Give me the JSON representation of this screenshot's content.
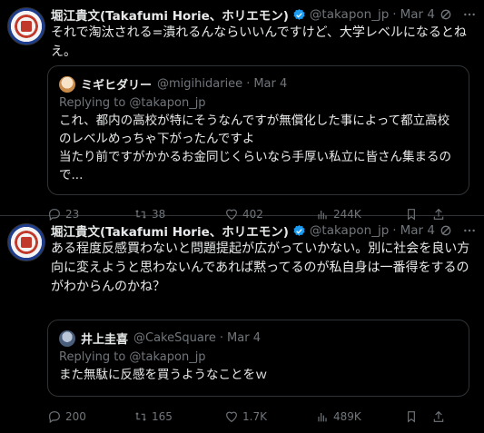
{
  "tweets": [
    {
      "name": "堀江貴文(Takafumi Horie、ホリエモン)",
      "handle": "@takapon_jp",
      "dot": "·",
      "date": "Mar 4",
      "text": "それで淘汰される=潰れるんならいいんですけど、大学レベルになるとね え。",
      "quote": {
        "name": "ミギヒダリー",
        "handle": "@migihidariee",
        "dot": "·",
        "date": "Mar 4",
        "reply": "Replying to @takapon_jp",
        "text": "これ、都内の高校が特にそうなんですが無償化した事によって都立高校のレベルめっちゃ下がったんですよ\n当たり前ですがかかるお金同じくらいなら手厚い私立に皆さん集まるので..."
      },
      "stats": {
        "replies": "23",
        "reposts": "38",
        "likes": "402",
        "views": "244K"
      }
    },
    {
      "name": "堀江貴文(Takafumi Horie、ホリエモン)",
      "handle": "@takapon_jp",
      "dot": "·",
      "date": "Mar 4",
      "text": "ある程度反感買わないと問題提起が広がっていかない。別に社会を良い方向に変えようと思わないんであれば黙ってるのが私自身は一番得をするのがわからんのかね？",
      "quote": {
        "name": "井上圭喜",
        "handle": "@CakeSquare",
        "dot": "·",
        "date": "Mar 4",
        "reply": "Replying to @takapon_jp",
        "text": "また無駄に反感を買うようなことをｗ"
      },
      "stats": {
        "replies": "200",
        "reposts": "165",
        "likes": "1.7K",
        "views": "489K"
      }
    }
  ],
  "colors": {
    "background": "#000000",
    "text": "#e7e9ea",
    "muted": "#71767b",
    "border": "#2f3336",
    "verified": "#1d9bf0"
  },
  "icons": [
    "verified-badge-icon",
    "grok-icon",
    "more-icon",
    "reply-icon",
    "repost-icon",
    "like-icon",
    "views-icon",
    "bookmark-icon",
    "share-icon"
  ]
}
